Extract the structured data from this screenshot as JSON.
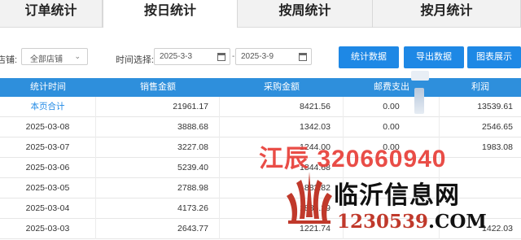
{
  "tabs": [
    {
      "label": "订单统计"
    },
    {
      "label": "按日统计"
    },
    {
      "label": "按周统计"
    },
    {
      "label": "按月统计"
    }
  ],
  "filters": {
    "store_label": "店铺:",
    "store_value": "全部店铺",
    "time_label": "时间选择:",
    "date_start": "2025-3-3",
    "date_end": "2025-3-9",
    "date_separator": "-"
  },
  "buttons": {
    "stats": "统计数据",
    "export": "导出数据",
    "chart": "图表展示"
  },
  "table": {
    "headers": [
      "统计时间",
      "销售金额",
      "采购金额",
      "邮费支出",
      "利润"
    ],
    "rows": [
      [
        "本页合计",
        "21961.17",
        "8421.56",
        "0.00",
        "13539.61"
      ],
      [
        "2025-03-08",
        "3888.68",
        "1342.03",
        "0.00",
        "2546.65"
      ],
      [
        "2025-03-07",
        "3227.08",
        "1244.00",
        "0.00",
        "1983.08"
      ],
      [
        "2025-03-06",
        "5239.40",
        "1844.68",
        "",
        ""
      ],
      [
        "2025-03-05",
        "2788.98",
        "882.82",
        "",
        ""
      ],
      [
        "2025-03-04",
        "4173.26",
        "1886.29",
        "",
        ""
      ],
      [
        "2025-03-03",
        "2643.77",
        "1221.74",
        "",
        "1422.03"
      ]
    ]
  },
  "watermark": {
    "phone": "江辰 320660940",
    "site_name": "临沂信息网",
    "site_url_num": "1230539",
    "site_url_tld": ".COM"
  }
}
